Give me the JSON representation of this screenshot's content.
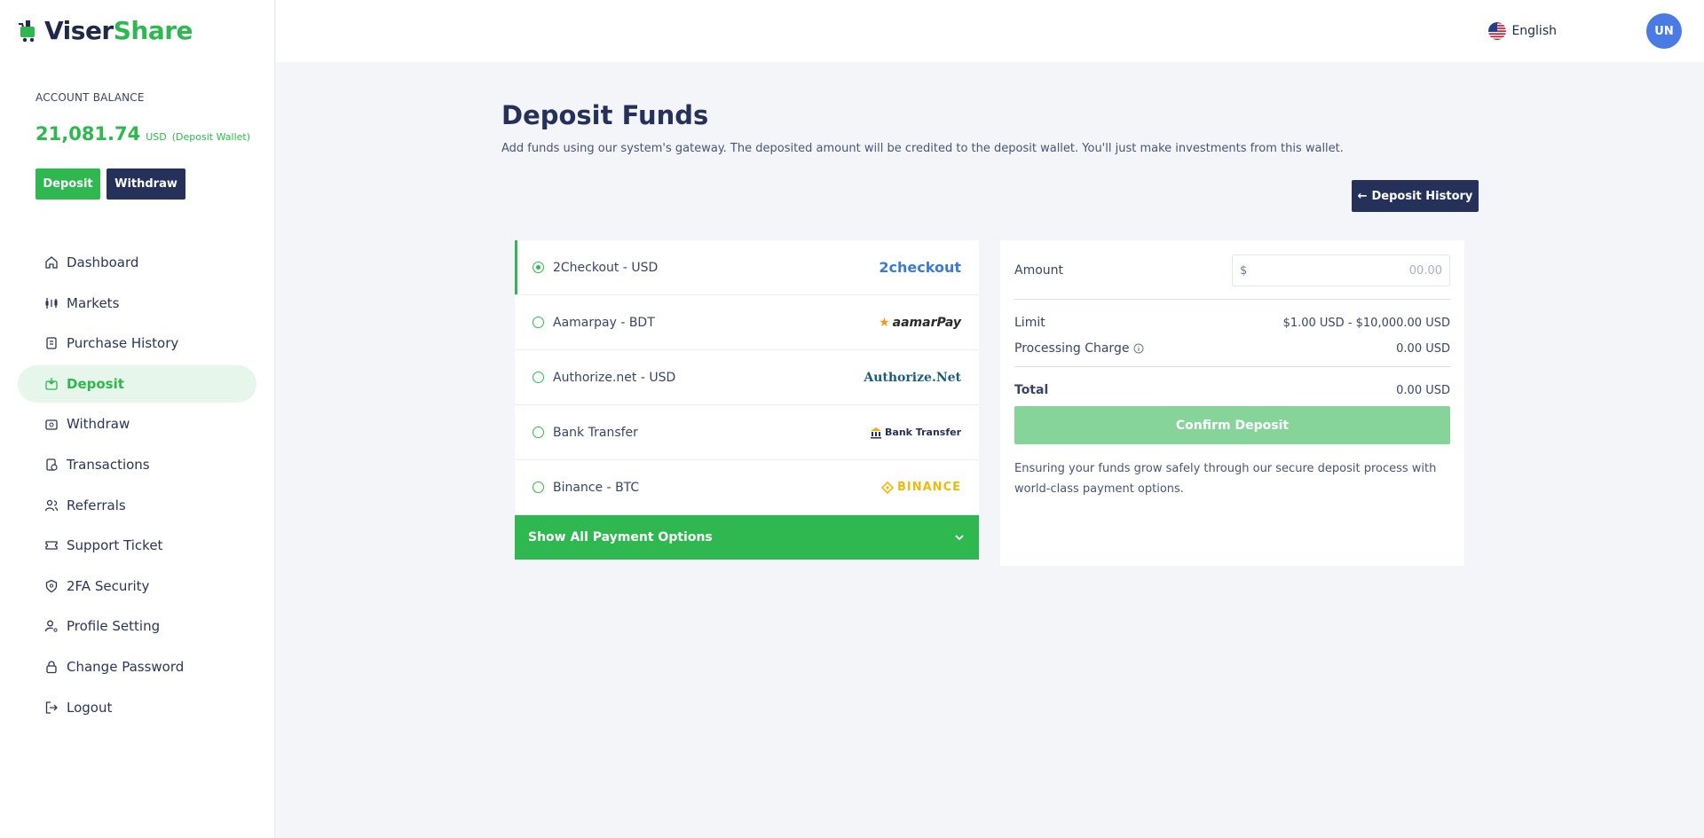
{
  "brand": {
    "name_part1": "Viser",
    "name_part2": "Share"
  },
  "account": {
    "label": "ACCOUNT BALANCE",
    "amount": "21,081.74",
    "currency": "USD",
    "wallet": "(Deposit Wallet)",
    "deposit_label": "Deposit",
    "withdraw_label": "Withdraw"
  },
  "nav": [
    {
      "label": "Dashboard",
      "icon": "home-icon",
      "active": false
    },
    {
      "label": "Markets",
      "icon": "markets-icon",
      "active": false
    },
    {
      "label": "Purchase History",
      "icon": "receipt-icon",
      "active": false
    },
    {
      "label": "Deposit",
      "icon": "deposit-icon",
      "active": true
    },
    {
      "label": "Withdraw",
      "icon": "withdraw-icon",
      "active": false
    },
    {
      "label": "Transactions",
      "icon": "transactions-icon",
      "active": false
    },
    {
      "label": "Referrals",
      "icon": "users-icon",
      "active": false
    },
    {
      "label": "Support Ticket",
      "icon": "ticket-icon",
      "active": false
    },
    {
      "label": "2FA Security",
      "icon": "shield-icon",
      "active": false
    },
    {
      "label": "Profile Setting",
      "icon": "user-gear-icon",
      "active": false
    },
    {
      "label": "Change Password",
      "icon": "lock-icon",
      "active": false
    },
    {
      "label": "Logout",
      "icon": "logout-icon",
      "active": false
    }
  ],
  "topbar": {
    "language": "English",
    "avatar_initials": "UN"
  },
  "page": {
    "title": "Deposit Funds",
    "description": "Add funds using our system's gateway. The deposited amount will be credited to the deposit wallet. You'll just make investments from this wallet.",
    "history_button": "Deposit History"
  },
  "gateways": [
    {
      "name": "2Checkout - USD",
      "logo_text": "2checkout",
      "selected": true
    },
    {
      "name": "Aamarpay - BDT",
      "logo_text": "aamarPay",
      "selected": false
    },
    {
      "name": "Authorize.net - USD",
      "logo_text": "Authorize.Net",
      "selected": false
    },
    {
      "name": "Bank Transfer",
      "logo_text": "Bank Transfer",
      "selected": false
    },
    {
      "name": "Binance - BTC",
      "logo_text": "BINANCE",
      "selected": false
    }
  ],
  "show_all_label": "Show All Payment Options",
  "summary": {
    "amount_label": "Amount",
    "currency_symbol": "$",
    "amount_placeholder": "00.00",
    "limit_label": "Limit",
    "limit_value": "$1.00 USD - $10,000.00 USD",
    "charge_label": "Processing Charge",
    "charge_value": "0.00 USD",
    "total_label": "Total",
    "total_value": "0.00 USD",
    "confirm_label": "Confirm Deposit",
    "note": "Ensuring your funds grow safely through our secure deposit process with world-class payment options."
  },
  "colors": {
    "accent": "#2eb84f",
    "navy": "#26315a",
    "confirm_disabled": "#86d49a"
  }
}
